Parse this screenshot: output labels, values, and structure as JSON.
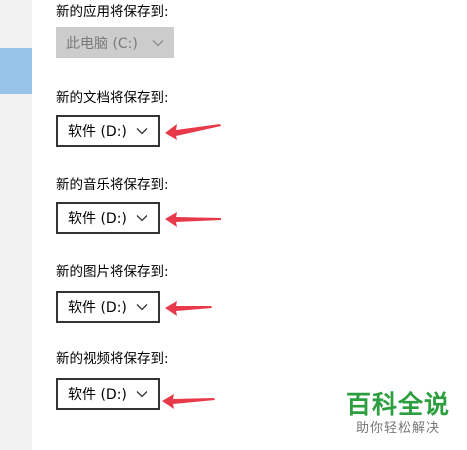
{
  "settings": {
    "apps": {
      "label": "新的应用将保存到:",
      "value": "此电脑 (C:)",
      "disabled": true
    },
    "documents": {
      "label": "新的文档将保存到:",
      "value": "软件 (D:)"
    },
    "music": {
      "label": "新的音乐将保存到:",
      "value": "软件 (D:)"
    },
    "pictures": {
      "label": "新的图片将保存到:",
      "value": "软件 (D:)"
    },
    "videos": {
      "label": "新的视频将保存到:",
      "value": "软件 (D:)"
    }
  },
  "watermark": {
    "title": "百科全说",
    "subtitle": "助你轻松解决"
  },
  "colors": {
    "annotation_arrow": "#e8394a",
    "sidebar_selected": "#99c4ea",
    "disabled_select_bg": "#cccccc",
    "watermark_green": "#2c9e3f"
  },
  "icons": {
    "dropdown": "chevron-down-icon",
    "annotation": "red-arrow-icon"
  }
}
